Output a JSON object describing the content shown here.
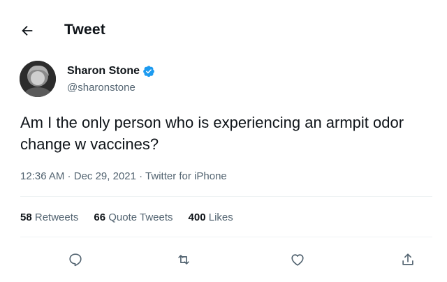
{
  "header": {
    "title": "Tweet",
    "back_icon": "arrow-left-icon"
  },
  "author": {
    "name": "Sharon Stone",
    "handle": "@sharonstone",
    "verified_icon": "verified-badge-icon",
    "verified_color": "#1d9bf0"
  },
  "tweet": {
    "text": "Am I the only person who is experiencing an armpit odor change w vaccines?",
    "time": "12:36 AM",
    "date": "Dec 29, 2021",
    "source": "Twitter for iPhone",
    "separator": " · "
  },
  "stats": {
    "retweets_count": "58",
    "retweets_label": "Retweets",
    "quotes_count": "66",
    "quotes_label": "Quote Tweets",
    "likes_count": "400",
    "likes_label": "Likes"
  },
  "actions": {
    "reply_icon": "reply-icon",
    "retweet_icon": "retweet-icon",
    "like_icon": "heart-icon",
    "share_icon": "share-icon"
  },
  "colors": {
    "text": "#0f1419",
    "secondary": "#536471",
    "divider": "#eff3f4",
    "accent": "#1d9bf0"
  }
}
